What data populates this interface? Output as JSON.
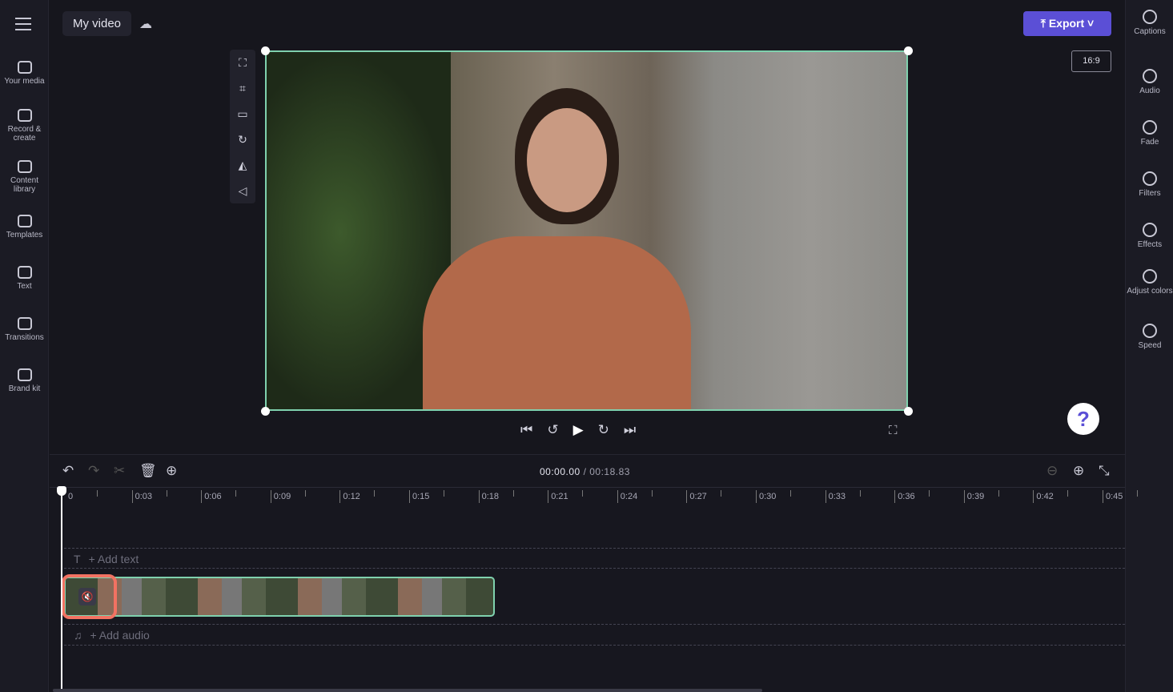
{
  "header": {
    "title": "My video",
    "export_label": "Export",
    "aspect_ratio": "16:9"
  },
  "left_sidebar": [
    {
      "label": "Your media",
      "icon": "folder-icon"
    },
    {
      "label": "Record & create",
      "icon": "camera-icon"
    },
    {
      "label": "Content library",
      "icon": "library-icon"
    },
    {
      "label": "Templates",
      "icon": "templates-icon"
    },
    {
      "label": "Text",
      "icon": "text-icon"
    },
    {
      "label": "Transitions",
      "icon": "transitions-icon"
    },
    {
      "label": "Brand kit",
      "icon": "brand-kit-icon"
    }
  ],
  "right_sidebar": [
    {
      "label": "Captions",
      "icon": "cc-icon"
    },
    {
      "label": "Audio",
      "icon": "speaker-icon"
    },
    {
      "label": "Fade",
      "icon": "fade-icon"
    },
    {
      "label": "Filters",
      "icon": "filters-icon"
    },
    {
      "label": "Effects",
      "icon": "magic-wand-icon"
    },
    {
      "label": "Adjust colors",
      "icon": "contrast-icon"
    },
    {
      "label": "Speed",
      "icon": "speedometer-icon"
    }
  ],
  "timeline": {
    "current_time": "00:00.00",
    "total_time": "/ 00:18.83",
    "ticks": [
      "0",
      "0:03",
      "0:06",
      "0:09",
      "0:12",
      "0:15",
      "0:18",
      "0:21",
      "0:24",
      "0:27",
      "0:30",
      "0:33",
      "0:36",
      "0:39",
      "0:42",
      "0:45"
    ],
    "add_text": "+ Add text",
    "add_audio": "+ Add audio"
  },
  "colors": {
    "accent": "#5b4fd6",
    "selection": "#7fd1ae",
    "highlight": "#f27262"
  }
}
